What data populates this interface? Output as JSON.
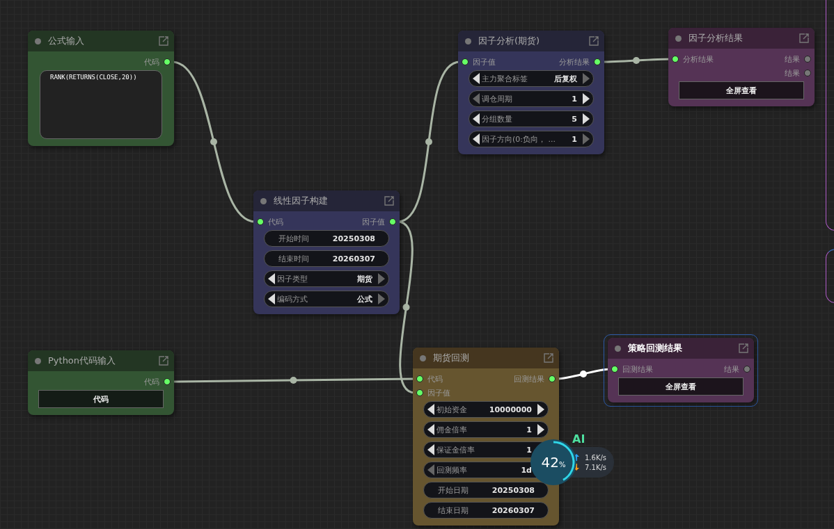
{
  "nodes": [
    {
      "title": "公式输入",
      "kind": "input",
      "selected": false,
      "outputs": [
        {
          "label": "代码",
          "connected": true
        }
      ],
      "widgets": [
        {
          "kind": "code",
          "value": "RANK(RETURNS(CLOSE,20))"
        }
      ]
    },
    {
      "title": "Python代码输入",
      "kind": "input",
      "selected": false,
      "outputs": [
        {
          "label": "代码",
          "connected": true
        }
      ],
      "widgets": [
        {
          "kind": "button",
          "label": "代码"
        }
      ]
    },
    {
      "title": "线性因子构建",
      "kind": "builder",
      "selected": false,
      "inputs": [
        {
          "label": "代码",
          "connected": true
        }
      ],
      "outputs": [
        {
          "label": "因子值",
          "connected": true
        }
      ],
      "widgets": [
        {
          "kind": "text",
          "label": "开始时间",
          "value": "20250308"
        },
        {
          "kind": "text",
          "label": "结束时间",
          "value": "20260307"
        },
        {
          "kind": "combo",
          "label": "因子类型",
          "value": "期货",
          "prev_enabled": true,
          "next_enabled": false
        },
        {
          "kind": "combo",
          "label": "编码方式",
          "value": "公式",
          "prev_enabled": true,
          "next_enabled": false
        }
      ]
    },
    {
      "title": "因子分析(期货)",
      "kind": "builder",
      "selected": false,
      "inputs": [
        {
          "label": "因子值",
          "connected": true
        }
      ],
      "outputs": [
        {
          "label": "分析结果",
          "connected": true
        }
      ],
      "widgets": [
        {
          "kind": "combo",
          "label": "主力聚合标签",
          "value": "后复权",
          "prev_enabled": true,
          "next_enabled": false
        },
        {
          "kind": "combo",
          "label": "调仓周期",
          "value": "1",
          "prev_enabled": false,
          "next_enabled": true
        },
        {
          "kind": "combo",
          "label": "分组数量",
          "value": "5",
          "prev_enabled": true,
          "next_enabled": true
        },
        {
          "kind": "combo",
          "label": "因子方向(0:负向，  ...",
          "value": "1",
          "prev_enabled": true,
          "next_enabled": false
        }
      ]
    },
    {
      "title": "因子分析结果",
      "kind": "result",
      "selected": false,
      "inputs": [
        {
          "label": "分析结果",
          "connected": true
        }
      ],
      "outputs": [
        {
          "label": "结果",
          "connected": false
        },
        {
          "label": "结果",
          "connected": false
        }
      ],
      "widgets": [
        {
          "kind": "button",
          "label": "全屏查看"
        }
      ]
    },
    {
      "title": "期货回测",
      "kind": "backtest",
      "selected": false,
      "inputs": [
        {
          "label": "代码",
          "connected": true
        },
        {
          "label": "因子值",
          "connected": true
        }
      ],
      "outputs": [
        {
          "label": "回测结果",
          "connected": true
        }
      ],
      "widgets": [
        {
          "kind": "combo",
          "label": "初始资金",
          "value": "10000000",
          "prev_enabled": true,
          "next_enabled": true
        },
        {
          "kind": "combo",
          "label": "佣金倍率",
          "value": "1",
          "prev_enabled": true,
          "next_enabled": true
        },
        {
          "kind": "combo",
          "label": "保证金倍率",
          "value": "1",
          "prev_enabled": true
        },
        {
          "kind": "combo",
          "label": "回测频率",
          "value": "1d",
          "prev_enabled": false
        },
        {
          "kind": "text",
          "label": "开始日期",
          "value": "20250308"
        },
        {
          "kind": "text",
          "label": "结束日期",
          "value": "20260307"
        }
      ]
    },
    {
      "title": "策略回测结果",
      "kind": "result",
      "selected": true,
      "inputs": [
        {
          "label": "回测结果",
          "connected": true
        }
      ],
      "outputs": [
        {
          "label": "结果",
          "connected": false
        }
      ],
      "widgets": [
        {
          "kind": "button",
          "label": "全屏查看"
        }
      ]
    }
  ],
  "links": [
    {
      "highlighted": false
    },
    {
      "highlighted": false
    },
    {
      "highlighted": false
    },
    {
      "highlighted": false
    },
    {
      "highlighted": false
    },
    {
      "highlighted": true
    }
  ],
  "ai_monitor": {
    "badge": "AI",
    "percent": "42",
    "unit": "%",
    "level": 0.42,
    "upload": "1.6K/s",
    "download": "7.1K/s"
  }
}
